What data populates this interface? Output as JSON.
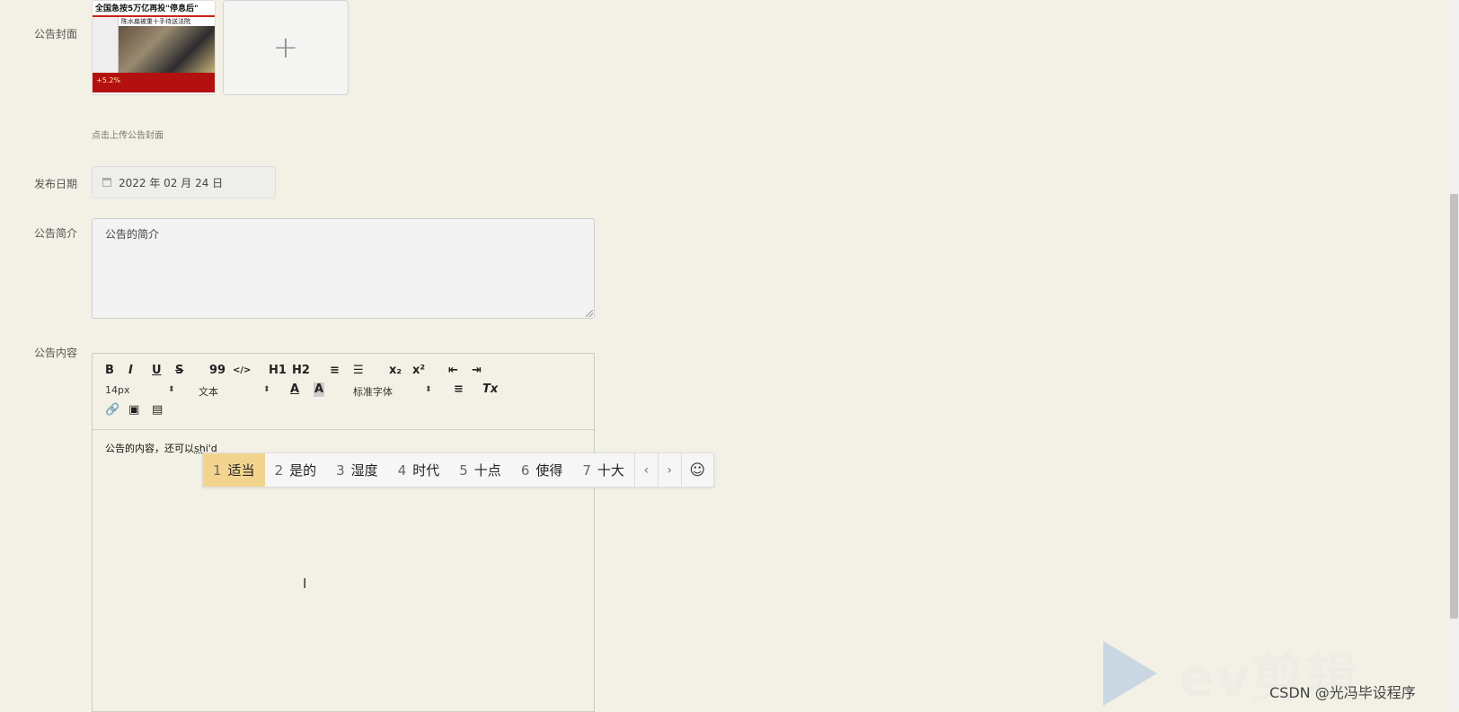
{
  "form": {
    "cover_label": "公告封面",
    "cover_thumb": {
      "headline": "全国急按5万亿再投\"停息后\"",
      "subheadline": "陈水扁被重十手待送法院",
      "footer_text": "+5.2%"
    },
    "upload_plus": "+",
    "upload_hint": "点击上传公告封面",
    "date_label": "发布日期",
    "date_value": "2022 年 02 月 24 日",
    "intro_label": "公告简介",
    "intro_value": "公告的简介",
    "content_label": "公告内容"
  },
  "editor": {
    "toolbar": {
      "bold": "B",
      "italic": "I",
      "underline": "U",
      "strike": "S",
      "quote": "99",
      "code": "</>",
      "h1": "H1",
      "h2": "H2",
      "ordered": "≡",
      "bullet": "☰",
      "sub": "x₂",
      "sup": "x²",
      "outdent": "⇤",
      "indent": "⇥",
      "size": "14px",
      "format": "文本",
      "font": "标准字体",
      "color": "A",
      "bg": "A",
      "align": "≡",
      "clean": "Tx",
      "link": "🔗",
      "image": "▣",
      "video": "▤"
    },
    "content_text": "公告的内容，还可以",
    "composing": "shi'd"
  },
  "ime": {
    "candidates": [
      {
        "num": "1",
        "text": "适当"
      },
      {
        "num": "2",
        "text": "是的"
      },
      {
        "num": "3",
        "text": "湿度"
      },
      {
        "num": "4",
        "text": "时代"
      },
      {
        "num": "5",
        "text": "十点"
      },
      {
        "num": "6",
        "text": "使得"
      },
      {
        "num": "7",
        "text": "十大"
      }
    ],
    "prev": "‹",
    "next": "›",
    "emoji": "☺"
  },
  "watermark": {
    "brand": "ev剪辑",
    "csdn": "CSDN @光冯毕设程序"
  },
  "colors": {
    "page_bg": "#f3f1e5",
    "ime_active": "#f2d48f"
  }
}
